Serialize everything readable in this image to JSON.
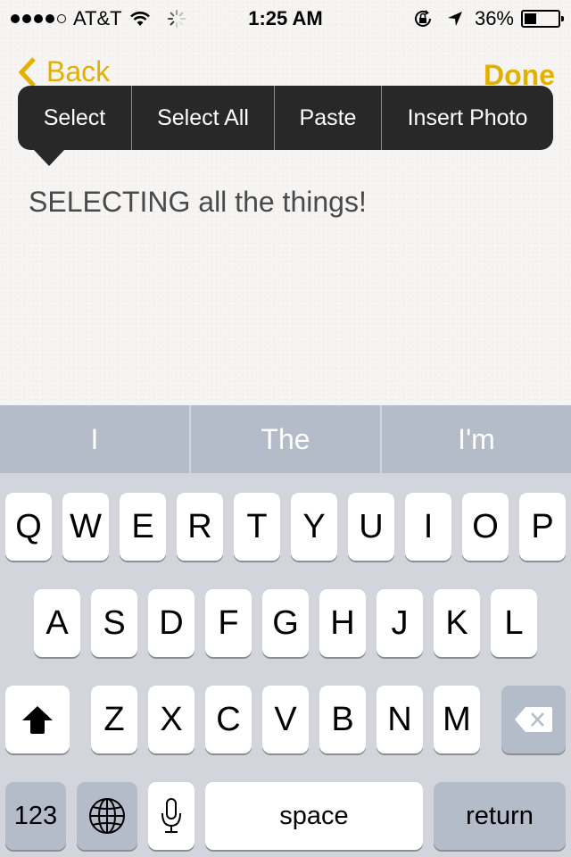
{
  "status_bar": {
    "signal_bars_filled": 4,
    "signal_bars_total": 5,
    "carrier": "AT&T",
    "time": "1:25 AM",
    "battery_percent": "36%",
    "battery_level": 0.36,
    "icons": [
      "wifi-icon",
      "activity-spinner-icon",
      "rotation-lock-icon",
      "location-arrow-icon",
      "battery-icon"
    ]
  },
  "nav": {
    "back_label": "Back",
    "done_label": "Done",
    "accent_color": "#e2b100"
  },
  "edit_menu": {
    "items": [
      "Select",
      "Select All",
      "Paste",
      "Insert Photo"
    ]
  },
  "note": {
    "text": "SELECTING all the things!"
  },
  "keyboard": {
    "suggestions": [
      "I",
      "The",
      "I'm"
    ],
    "row1": [
      "Q",
      "W",
      "E",
      "R",
      "T",
      "Y",
      "U",
      "I",
      "O",
      "P"
    ],
    "row2": [
      "A",
      "S",
      "D",
      "F",
      "G",
      "H",
      "J",
      "K",
      "L"
    ],
    "row3": [
      "Z",
      "X",
      "C",
      "V",
      "B",
      "N",
      "M"
    ],
    "numbers_label": "123",
    "space_label": "space",
    "return_label": "return"
  }
}
